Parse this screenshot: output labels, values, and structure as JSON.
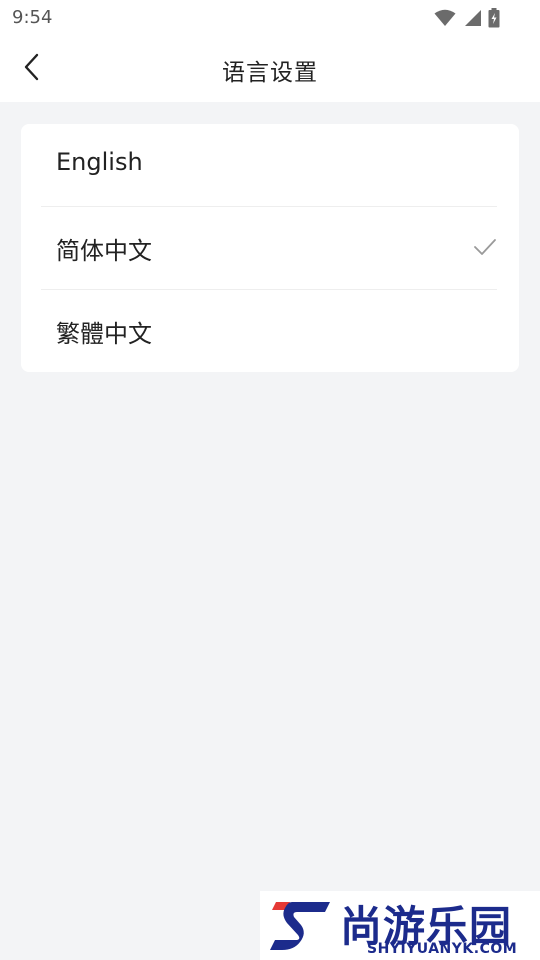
{
  "status_bar": {
    "time": "9:54",
    "icons": [
      "wifi-icon",
      "cellular-signal-icon",
      "battery-charging-icon"
    ]
  },
  "header": {
    "back_icon": "chevron-left-icon",
    "title": "语言设置"
  },
  "languages": [
    {
      "label": "English",
      "selected": false
    },
    {
      "label": "简体中文",
      "selected": true
    },
    {
      "label": "繁體中文",
      "selected": false
    }
  ],
  "colors": {
    "page_background": "#f3f4f6",
    "card_background": "#ffffff",
    "check_color": "#9a9a9a",
    "watermark_blue": "#1c2b8c",
    "watermark_red": "#e53935"
  },
  "watermark": {
    "title": "尚游乐园",
    "url": "SHYIYUANYK.COM"
  }
}
